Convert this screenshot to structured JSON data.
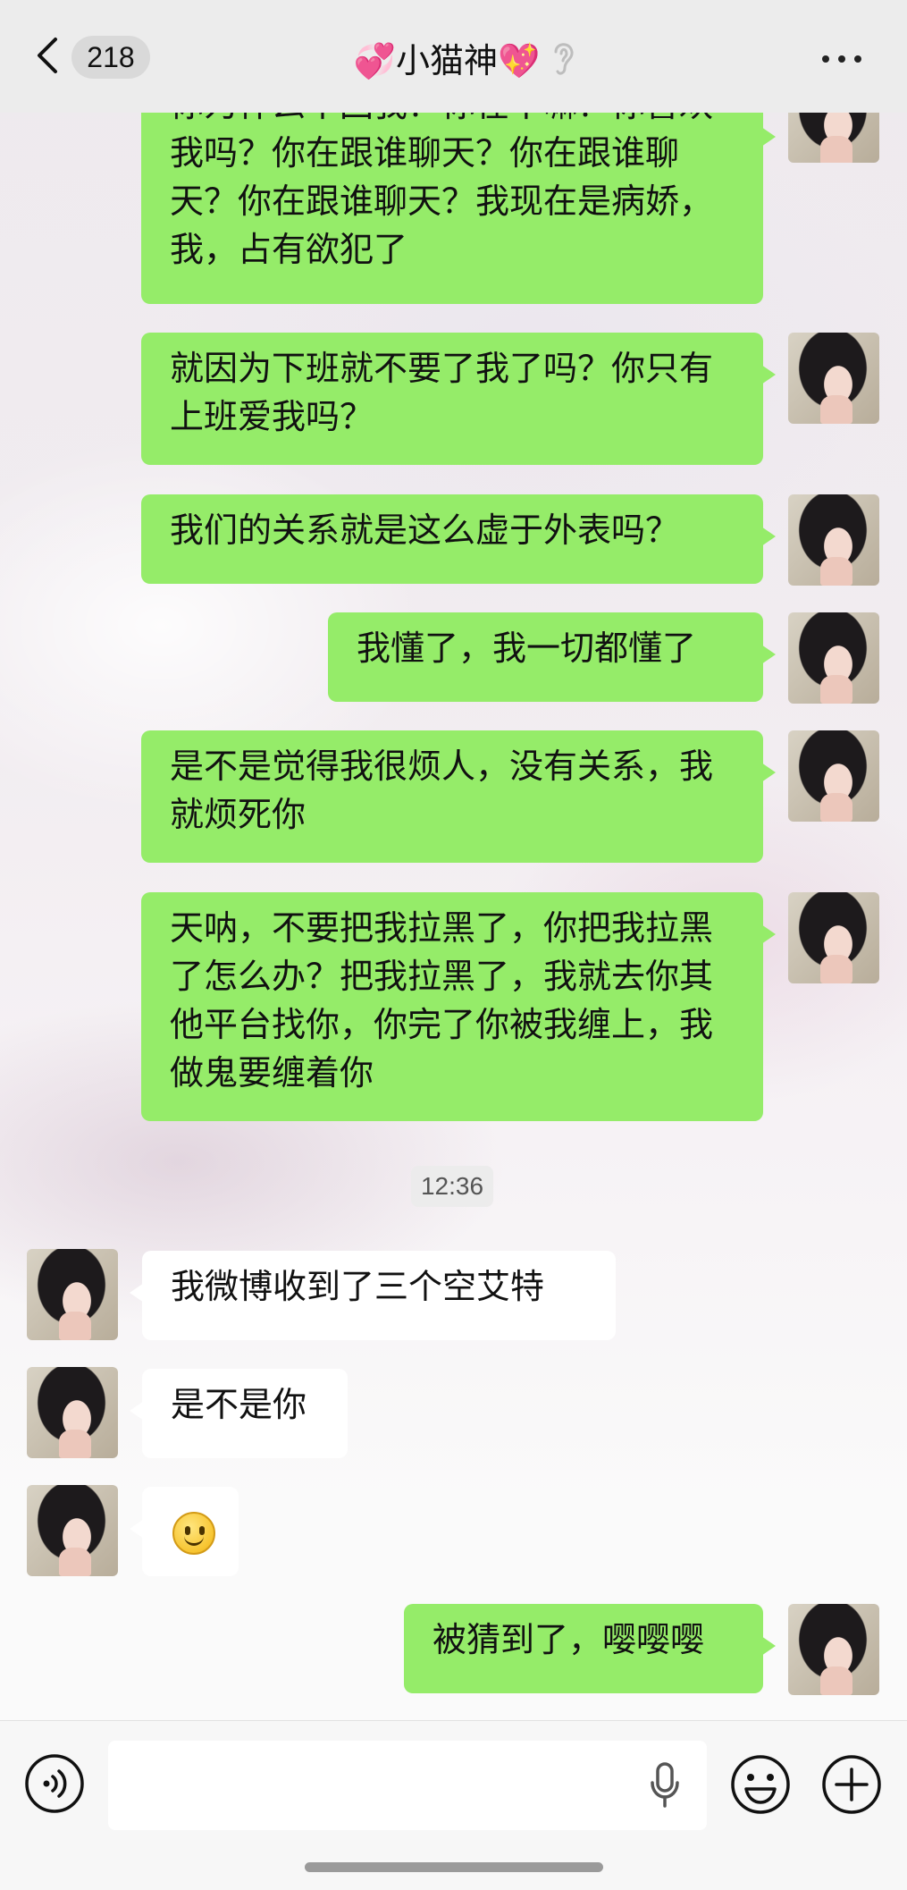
{
  "header": {
    "unread_count": "218",
    "title": "💞小猫神💖"
  },
  "messages": [
    {
      "sender": "me",
      "text": "你为什么不回我？你在干嘛？你喜欢我吗？你在跟谁聊天？你在跟谁聊天？你在跟谁聊天？我现在是病娇，我，占有欲犯了"
    },
    {
      "sender": "me",
      "text": "就因为下班就不要了我了吗？你只有上班爱我吗？"
    },
    {
      "sender": "me",
      "text": "我们的关系就是这么虚于外表吗？"
    },
    {
      "sender": "me",
      "text": "我懂了，我一切都懂了"
    },
    {
      "sender": "me",
      "text": "是不是觉得我很烦人，没有关系，我就烦死你"
    },
    {
      "sender": "me",
      "text": "天呐，不要把我拉黑了，你把我拉黑了怎么办？把我拉黑了，我就去你其他平台找你，你完了你被我缠上，我做鬼要缠着你"
    },
    {
      "sender": "them",
      "text": "我微博收到了三个空艾特"
    },
    {
      "sender": "them",
      "text": "是不是你"
    },
    {
      "sender": "them",
      "sticker": "smile-emoji"
    },
    {
      "sender": "me",
      "text": "被猜到了，嘤嘤嘤"
    }
  ],
  "timestamp": "12:36",
  "input_bar": {
    "placeholder": ""
  },
  "icons": {
    "back": "chevron-left-icon",
    "mute": "ear-icon",
    "more": "more-dots-icon",
    "voice": "voice-icon",
    "mic": "mic-icon",
    "emoji": "emoji-icon",
    "plus": "plus-icon"
  },
  "colors": {
    "my_bubble": "#95ec69",
    "their_bubble": "#ffffff",
    "header_bg": "#ececec"
  }
}
